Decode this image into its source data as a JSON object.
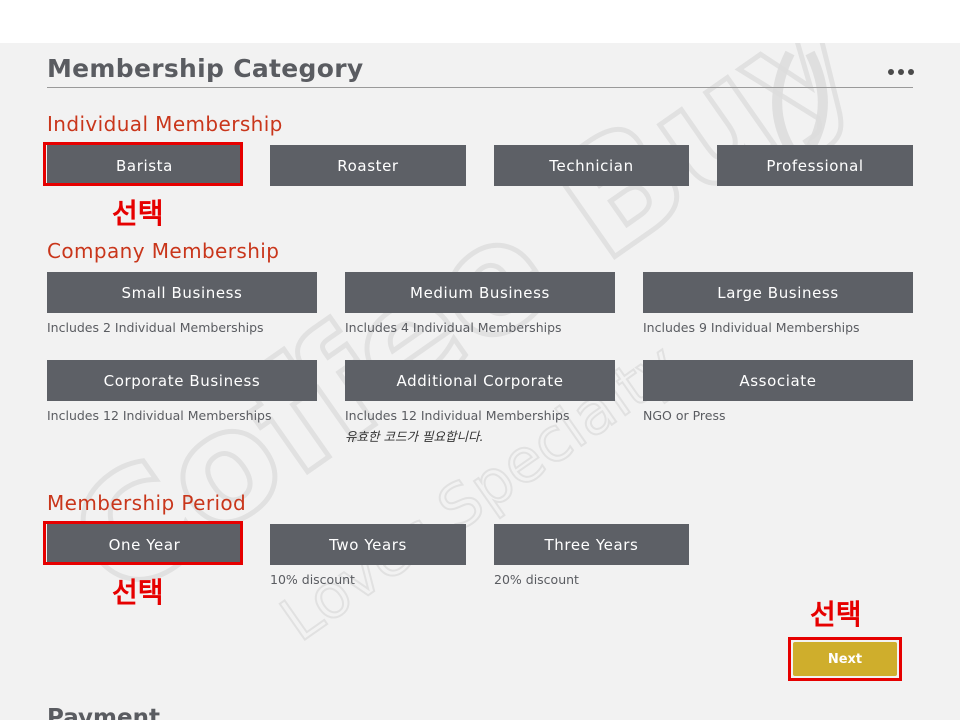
{
  "header": {
    "title": "Membership Category",
    "more_icon": "ellipsis-icon"
  },
  "individual": {
    "title": "Individual Membership",
    "buttons": [
      "Barista",
      "Roaster",
      "Technician",
      "Professional"
    ]
  },
  "company": {
    "title": "Company Membership",
    "items": [
      {
        "label": "Small Business",
        "desc": "Includes 2 Individual Memberships"
      },
      {
        "label": "Medium Business",
        "desc": "Includes 4 Individual Memberships"
      },
      {
        "label": "Large Business",
        "desc": "Includes 9 Individual Memberships"
      },
      {
        "label": "Corporate Business",
        "desc": "Includes 12 Individual Memberships"
      },
      {
        "label": "Additional Corporate",
        "desc": "Includes 12 Individual Memberships",
        "note": "유효한 코드가 필요합니다."
      },
      {
        "label": "Associate",
        "desc": "NGO or Press"
      }
    ]
  },
  "period": {
    "title": "Membership Period",
    "items": [
      {
        "label": "One Year",
        "desc": ""
      },
      {
        "label": "Two Years",
        "desc": "10% discount"
      },
      {
        "label": "Three Years",
        "desc": "20% discount"
      }
    ]
  },
  "annotations": {
    "select_label": "선택"
  },
  "actions": {
    "next_label": "Next"
  },
  "payment": {
    "title": "Payment"
  },
  "colors": {
    "button": "#5d6066",
    "accent": "#c9361b",
    "highlight": "#e60000",
    "next": "#cfae2c"
  }
}
